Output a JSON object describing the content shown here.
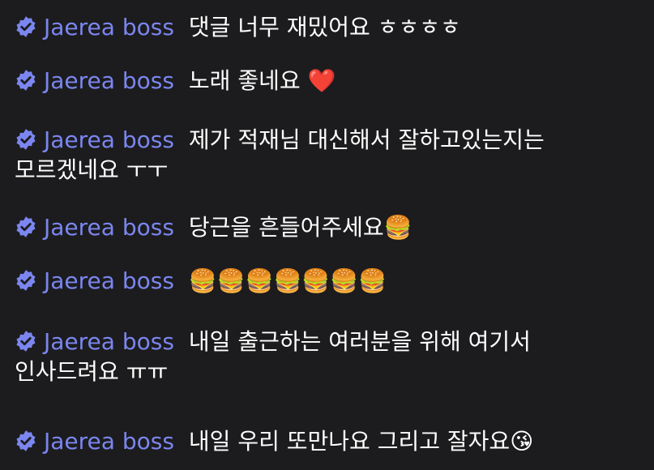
{
  "chat": {
    "messages": [
      {
        "author": "Jaerea boss",
        "text": "댓글 너무 재밌어요 ㅎㅎㅎㅎ"
      },
      {
        "author": "Jaerea boss",
        "text": "노래 좋네요 ❤️"
      },
      {
        "author": "Jaerea boss",
        "text": "제가 적재님 대신해서 잘하고있는지는 모르겠네요 ㅜㅜ"
      },
      {
        "author": "Jaerea boss",
        "text": "당근을 흔들어주세요🍔"
      },
      {
        "author": "Jaerea boss",
        "text": "🍔🍔🍔🍔🍔🍔🍔"
      },
      {
        "author": "Jaerea boss",
        "text": "내일 출근하는 여러분을 위해 여기서 인사드려요 ㅠㅠ"
      },
      {
        "author": "Jaerea boss",
        "text": "내일 우리 또만나요 그리고 잘자요😘"
      }
    ]
  },
  "colors": {
    "background": "#1c1c1e",
    "author": "#7b86f0",
    "badge": "#7b86f0",
    "text": "#ffffff"
  },
  "icons": {
    "badge": "verified-badge-icon"
  }
}
